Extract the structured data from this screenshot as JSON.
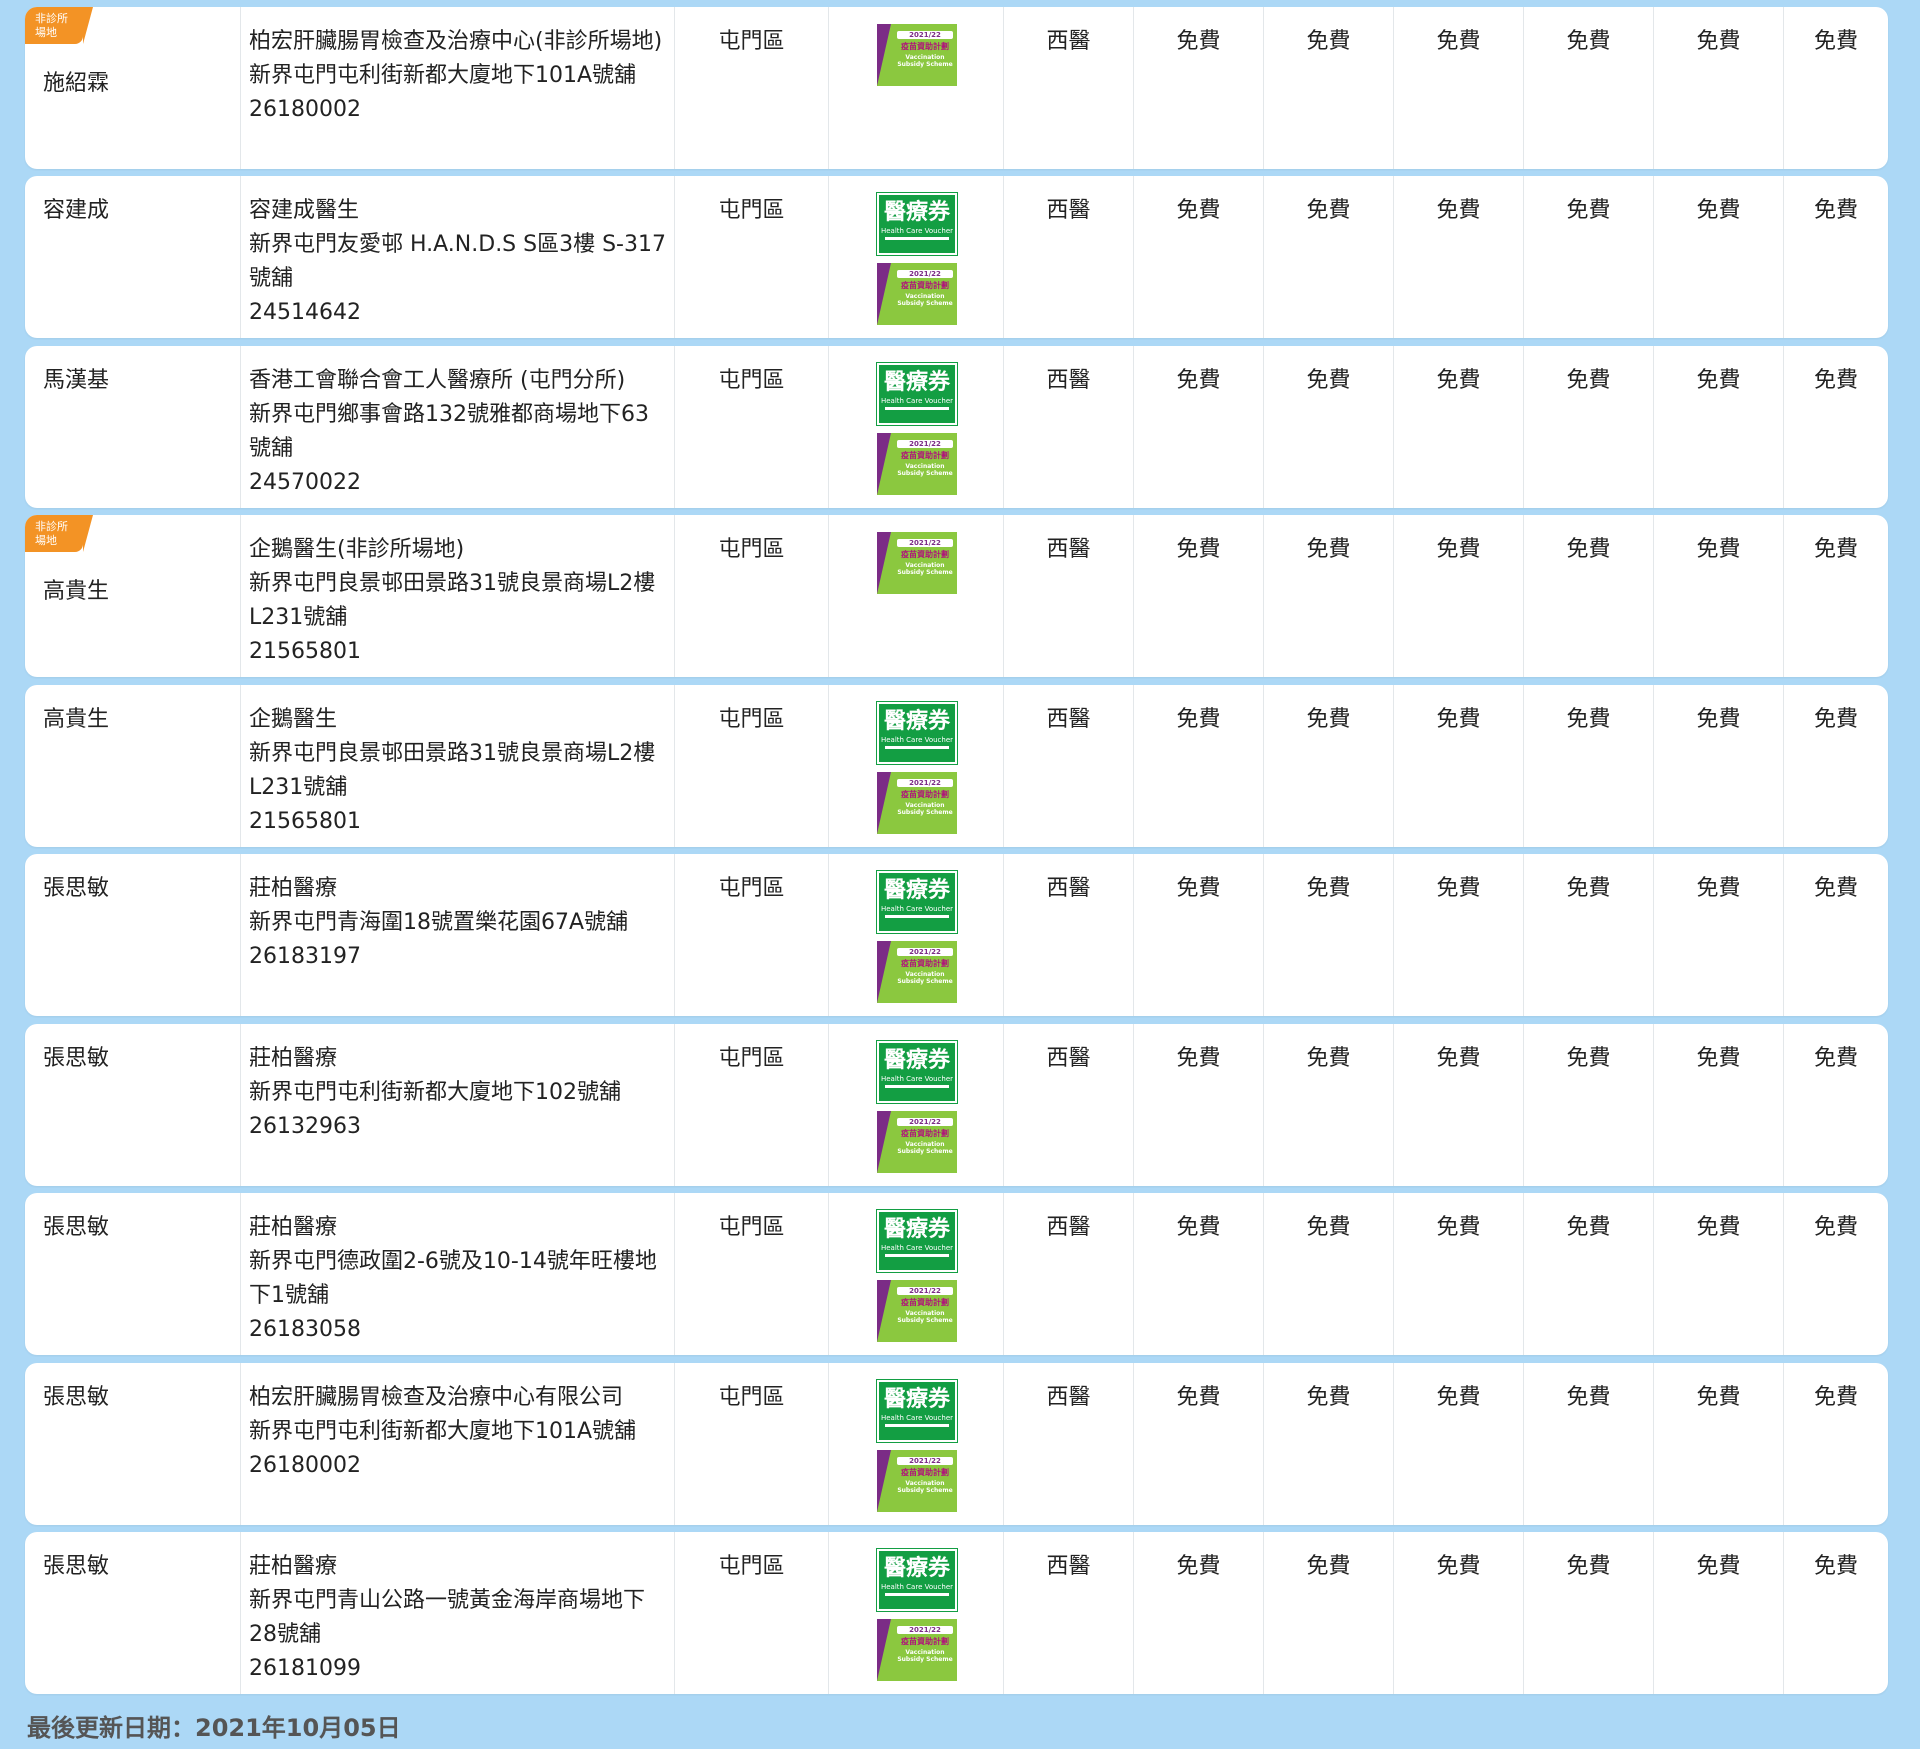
{
  "badge": {
    "line1": "非診所",
    "line2": "場地"
  },
  "icons": {
    "hcv": {
      "title": "醫療券",
      "subtitle": "Health Care Voucher"
    },
    "vss": {
      "year": "2021/22",
      "title": "疫苗資助計劃",
      "subtitle": "Vaccination Subsidy Scheme"
    }
  },
  "rows": [
    {
      "name": "施紹霖",
      "badge": true,
      "info": [
        "柏宏肝臟腸胃檢查及治療中心(非診所場地)",
        "新界屯門屯利街新都大廈地下101A號舖",
        "26180002"
      ],
      "district": "屯門區",
      "hcv": false,
      "vss": true,
      "type": "西醫",
      "fees": [
        "免費",
        "免費",
        "免費",
        "免費",
        "免費",
        "免費",
        "免費"
      ]
    },
    {
      "name": "容建成",
      "badge": false,
      "info": [
        "容建成醫生",
        "新界屯門友愛邨 H.A.N.D.S S區3樓 S-317號舖",
        "24514642"
      ],
      "district": "屯門區",
      "hcv": true,
      "vss": true,
      "type": "西醫",
      "fees": [
        "免費",
        "免費",
        "免費",
        "免費",
        "免費",
        "免費",
        "免費"
      ]
    },
    {
      "name": "馬漢基",
      "badge": false,
      "info": [
        "香港工會聯合會工人醫療所 (屯門分所)",
        "新界屯門鄉事會路132號雅都商場地下63號舖",
        "24570022"
      ],
      "district": "屯門區",
      "hcv": true,
      "vss": true,
      "type": "西醫",
      "fees": [
        "免費",
        "免費",
        "免費",
        "免費",
        "免費",
        "免費",
        "免費"
      ]
    },
    {
      "name": "高貴生",
      "badge": true,
      "info": [
        "企鵝醫生(非診所場地)",
        "新界屯門良景邨田景路31號良景商場L2樓L231號舖",
        "21565801"
      ],
      "district": "屯門區",
      "hcv": false,
      "vss": true,
      "type": "西醫",
      "fees": [
        "免費",
        "免費",
        "免費",
        "免費",
        "免費",
        "免費",
        "免費"
      ]
    },
    {
      "name": "高貴生",
      "badge": false,
      "info": [
        "企鵝醫生",
        "新界屯門良景邨田景路31號良景商場L2樓L231號舖",
        "21565801"
      ],
      "district": "屯門區",
      "hcv": true,
      "vss": true,
      "type": "西醫",
      "fees": [
        "免費",
        "免費",
        "免費",
        "免費",
        "免費",
        "免費",
        "免費"
      ]
    },
    {
      "name": "張思敏",
      "badge": false,
      "info": [
        "莊柏醫療",
        "新界屯門青海圍18號置樂花園67A號舖",
        "26183197"
      ],
      "district": "屯門區",
      "hcv": true,
      "vss": true,
      "type": "西醫",
      "fees": [
        "免費",
        "免費",
        "免費",
        "免費",
        "免費",
        "免費",
        "免費"
      ]
    },
    {
      "name": "張思敏",
      "badge": false,
      "info": [
        "莊柏醫療",
        "新界屯門屯利街新都大廈地下102號舖",
        "26132963"
      ],
      "district": "屯門區",
      "hcv": true,
      "vss": true,
      "type": "西醫",
      "fees": [
        "免費",
        "免費",
        "免費",
        "免費",
        "免費",
        "免費",
        "免費"
      ]
    },
    {
      "name": "張思敏",
      "badge": false,
      "info": [
        "莊柏醫療",
        "新界屯門德政圍2-6號及10-14號年旺樓地下1號舖",
        "26183058"
      ],
      "district": "屯門區",
      "hcv": true,
      "vss": true,
      "type": "西醫",
      "fees": [
        "免費",
        "免費",
        "免費",
        "免費",
        "免費",
        "免費",
        "免費"
      ]
    },
    {
      "name": "張思敏",
      "badge": false,
      "info": [
        "柏宏肝臟腸胃檢查及治療中心有限公司",
        "新界屯門屯利街新都大廈地下101A號舖",
        "26180002"
      ],
      "district": "屯門區",
      "hcv": true,
      "vss": true,
      "type": "西醫",
      "fees": [
        "免費",
        "免費",
        "免費",
        "免費",
        "免費",
        "免費",
        "免費"
      ]
    },
    {
      "name": "張思敏",
      "badge": false,
      "info": [
        "莊柏醫療",
        "新界屯門青山公路一號黃金海岸商場地下28號舖",
        "26181099"
      ],
      "district": "屯門區",
      "hcv": true,
      "vss": true,
      "type": "西醫",
      "fees": [
        "免費",
        "免費",
        "免費",
        "免費",
        "免費",
        "免費",
        "免費"
      ]
    }
  ],
  "footer": {
    "text": "最後更新日期：2021年10月05日"
  }
}
